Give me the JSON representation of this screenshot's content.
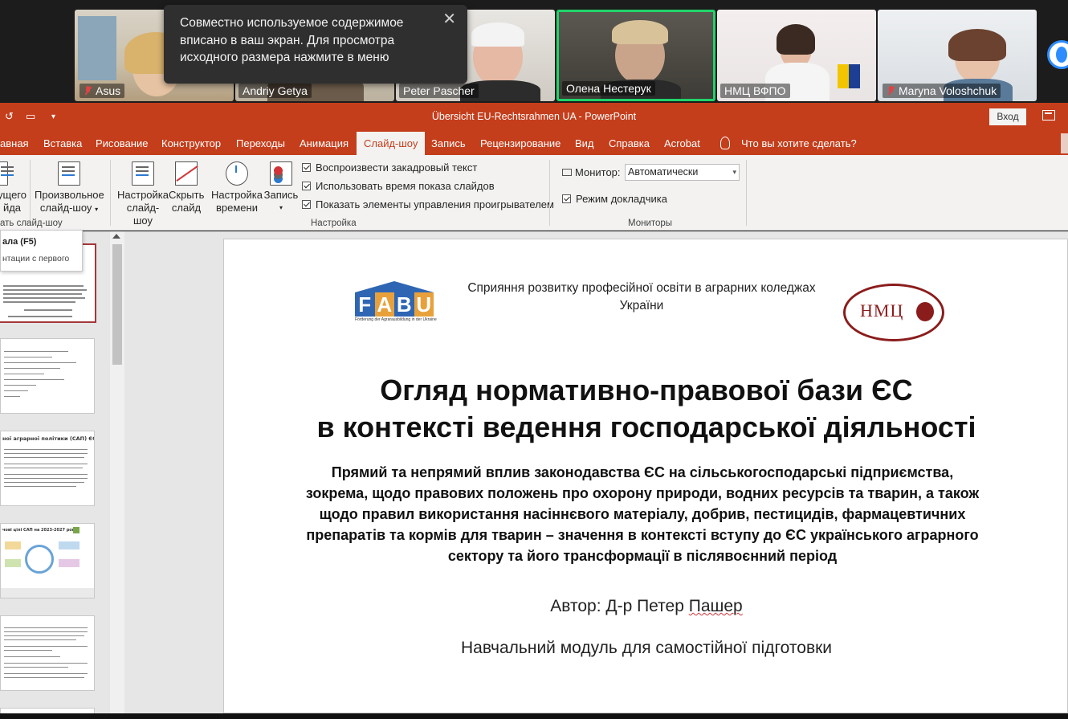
{
  "participants": [
    {
      "name": "Asus",
      "muted": true
    },
    {
      "name": "Andriy Getya",
      "muted": false
    },
    {
      "name": "Peter Pascher",
      "muted": false
    },
    {
      "name": "Олена Нестерук",
      "muted": false,
      "active": true
    },
    {
      "name": "НМЦ ВФПО",
      "muted": false
    },
    {
      "name": "Maryna Voloshchuk",
      "muted": true
    }
  ],
  "notification": {
    "text": "Совместно используемое содержимое вписано в ваш экран. Для просмотра исходного размера нажмите в меню",
    "close": "✕"
  },
  "ppt": {
    "document_title": "Übersicht EU-Rechtsrahmen UA  -  PowerPoint",
    "login": "Вход"
  },
  "tabs": [
    {
      "label": "авная"
    },
    {
      "label": "Вставка"
    },
    {
      "label": "Рисование"
    },
    {
      "label": "Конструктор"
    },
    {
      "label": "Переходы"
    },
    {
      "label": "Анимация"
    },
    {
      "label": "Слайд-шоу",
      "selected": true
    },
    {
      "label": "Запись"
    },
    {
      "label": "Рецензирование"
    },
    {
      "label": "Вид"
    },
    {
      "label": "Справка"
    },
    {
      "label": "Acrobat"
    },
    {
      "label": "Что вы хотите сделать?"
    }
  ],
  "ribbon": {
    "from_current_l1": "ущего",
    "from_current_l2": "йда",
    "custom_l1": "Произвольное",
    "custom_l2": "слайд-шоу",
    "start_group": "ать слайд-шоу",
    "setup_l1": "Настройка",
    "setup_l2": "слайд-шоу",
    "hide_l1": "Скрыть",
    "hide_l2": "слайд",
    "timing_l1": "Настройка",
    "timing_l2": "времени",
    "record_l1": "Запись",
    "check_narration": "Воспроизвести закадровый текст",
    "check_timings": "Использовать время показа слайдов",
    "check_controls": "Показать элементы управления проигрывателем",
    "setup_group": "Настройка",
    "monitor_label": "Монитор:",
    "monitor_value": "Автоматически",
    "presenter_view": "Режим докладчика",
    "monitors_group": "Мониторы"
  },
  "tooltip": {
    "title": "ала (F5)",
    "desc": "нтации с первого"
  },
  "slide": {
    "fabu_letters": [
      "F",
      "A",
      "B",
      "U"
    ],
    "fabu_sub": "Förderung der Agrarausbildung in der Ukraine",
    "header": "Сприяння розвитку професійної освіти в аграрних коледжах України",
    "nmc": "НМЦ",
    "title_l1": "Огляд нормативно-правової бази ЄС",
    "title_l2": "в контексті ведення господарської діяльності",
    "subtitle": "Прямий та непрямий вплив законодавства ЄС на сільськогосподарські підприємства, зокрема, щодо правових положень про охорону природи, водних ресурсів та тварин, а також щодо правил використання насіннєвого матеріалу, добрив, пестицидів, фармацевтичних препаратів та кормів для тварин – значення в контексті вступу до ЄС українського аграрного сектору та його трансформації в післявоєнний період",
    "author_prefix": "Автор: Д-р Петер ",
    "author_name": "Пашер",
    "module": "Навчальний модуль для самостійної підготовки"
  },
  "thumbnails": {
    "t3_title": "ної аграрної політики (САП) ЄС",
    "t4_title": "чові цілі САП на 2023-2027 роки"
  },
  "colors": {
    "ppt_accent": "#c43e1c",
    "active_speaker": "#22d36a",
    "muted": "#e04343"
  }
}
